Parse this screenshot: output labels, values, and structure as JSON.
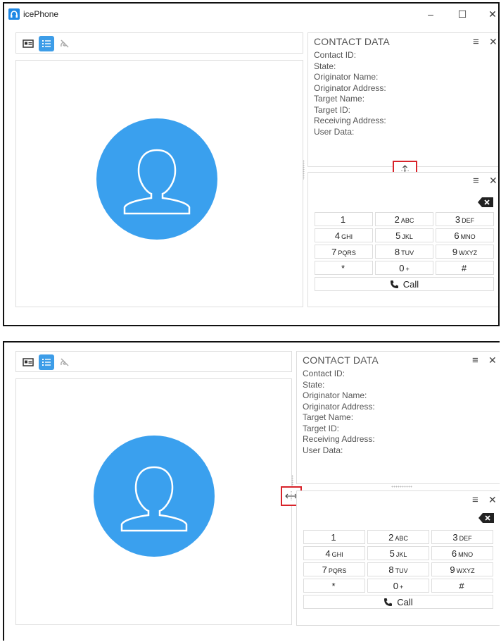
{
  "window": {
    "title": "icePhone"
  },
  "toolbar": {
    "buttons": [
      "contact-card",
      "list",
      "hangup"
    ]
  },
  "contact": {
    "title": "CONTACT DATA",
    "fields": [
      "Contact ID:",
      "State:",
      "Originator Name:",
      "Originator Address:",
      "Target Name:",
      "Target ID:",
      "Receiving Address:",
      "User Data:"
    ]
  },
  "dialpad": {
    "keys": [
      {
        "num": "1",
        "sub": ""
      },
      {
        "num": "2",
        "sub": "ABC"
      },
      {
        "num": "3",
        "sub": "DEF"
      },
      {
        "num": "4",
        "sub": "GHI"
      },
      {
        "num": "5",
        "sub": "JKL"
      },
      {
        "num": "6",
        "sub": "MNO"
      },
      {
        "num": "7",
        "sub": "PQRS"
      },
      {
        "num": "8",
        "sub": "TUV"
      },
      {
        "num": "9",
        "sub": "WXYZ"
      },
      {
        "num": "*",
        "sub": ""
      },
      {
        "num": "0",
        "sub": "+"
      },
      {
        "num": "#",
        "sub": ""
      }
    ],
    "call_label": "Call"
  },
  "colors": {
    "accent": "#3d9de8",
    "avatar": "#3aa0ee",
    "highlight": "#d8232a"
  }
}
